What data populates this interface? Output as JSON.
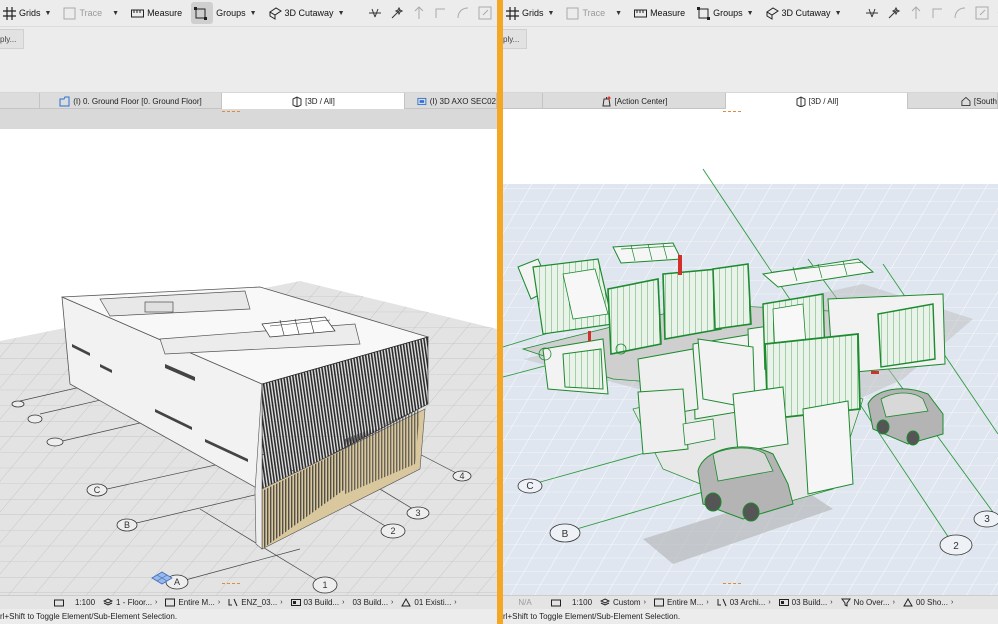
{
  "left_pane": {
    "toolbar": {
      "grids": "Grids",
      "trace": "Trace",
      "measure": "Measure",
      "groups": "Groups",
      "cutaway": "3D Cutaway"
    },
    "apply_tab": "ply...",
    "tabs": [
      {
        "label": "(I) 0. Ground Floor [0. Ground Floor]",
        "icon": "floor-plan-icon"
      },
      {
        "label": "[3D / All]",
        "icon": "3d-view-icon"
      },
      {
        "label": "(I) 3D AXO SEC02",
        "icon": "axo-section-icon"
      }
    ],
    "grid_markers": [
      "C",
      "B",
      "A",
      "1",
      "2",
      "3",
      "4"
    ],
    "status": {
      "na": "",
      "scale": "1:100",
      "layer": "1 - Floor...",
      "model": "Entire M...",
      "pen": "ENZ_03...",
      "build1": "03 Build...",
      "build2": "03 Build...",
      "existing": "01 Existi..."
    },
    "hint": "rl+Shift to Toggle Element/Sub-Element Selection."
  },
  "right_pane": {
    "toolbar": {
      "grids": "Grids",
      "trace": "Trace",
      "measure": "Measure",
      "groups": "Groups",
      "cutaway": "3D Cutaway"
    },
    "apply_tab": "ply...",
    "tabs": [
      {
        "label": "[Action Center]",
        "icon": "action-center-icon"
      },
      {
        "label": "[3D / All]",
        "icon": "3d-view-icon"
      },
      {
        "label": "[South",
        "icon": "elevation-icon"
      }
    ],
    "grid_markers": [
      "C",
      "B",
      "2",
      "3"
    ],
    "status": {
      "na": "N/A",
      "scale": "1:100",
      "layer": "Custom",
      "model": "Entire M...",
      "pen": "03 Archi...",
      "build1": "03 Build...",
      "overrides": "No Over...",
      "show": "00 Sho..."
    },
    "hint": "rl+Shift to Toggle Element/Sub-Element Selection."
  },
  "colors": {
    "divider": "#f5a623",
    "highlight_green": "#1c8a2e",
    "toolbar_bg": "#ececec"
  }
}
